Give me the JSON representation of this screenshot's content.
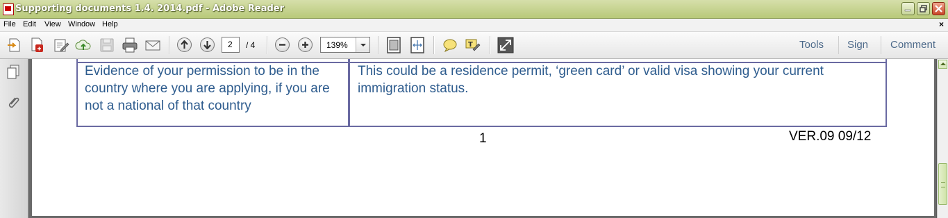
{
  "window": {
    "title": "Supporting documents 1.4. 2014.pdf - Adobe Reader"
  },
  "menu": [
    "File",
    "Edit",
    "View",
    "Window",
    "Help"
  ],
  "menu_close_glyph": "×",
  "toolbar": {
    "icons": [
      "open-icon",
      "create-pdf-icon",
      "edit-icon",
      "cloud-upload-icon",
      "save-icon",
      "print-icon",
      "email-icon",
      "previous-page-icon",
      "next-page-icon",
      "zoom-out-icon",
      "zoom-in-icon",
      "fit-page-icon",
      "fit-width-icon",
      "sticky-note-icon",
      "highlight-text-icon",
      "full-screen-icon"
    ],
    "page_current": "2",
    "page_total": "/ 4",
    "zoom_value": "139%",
    "tools_label": "Tools",
    "sign_label": "Sign",
    "comment_label": "Comment"
  },
  "left_panel": {
    "icons": [
      "pages-icon",
      "attachment-icon"
    ]
  },
  "document": {
    "table_row": {
      "left_cell": "Evidence of your permission to be in the country where you are applying, if you are not a national of that country",
      "right_cell": "This could be a residence permit, ‘green card’ or valid visa showing your current immigration status."
    },
    "page_number": "1",
    "version": "VER.09 09/12"
  },
  "colors": {
    "title_bar": "#c4d28c",
    "doc_text": "#2e5c8e",
    "table_border": "#6a6aa2",
    "panel_link": "#4d6a8a"
  }
}
